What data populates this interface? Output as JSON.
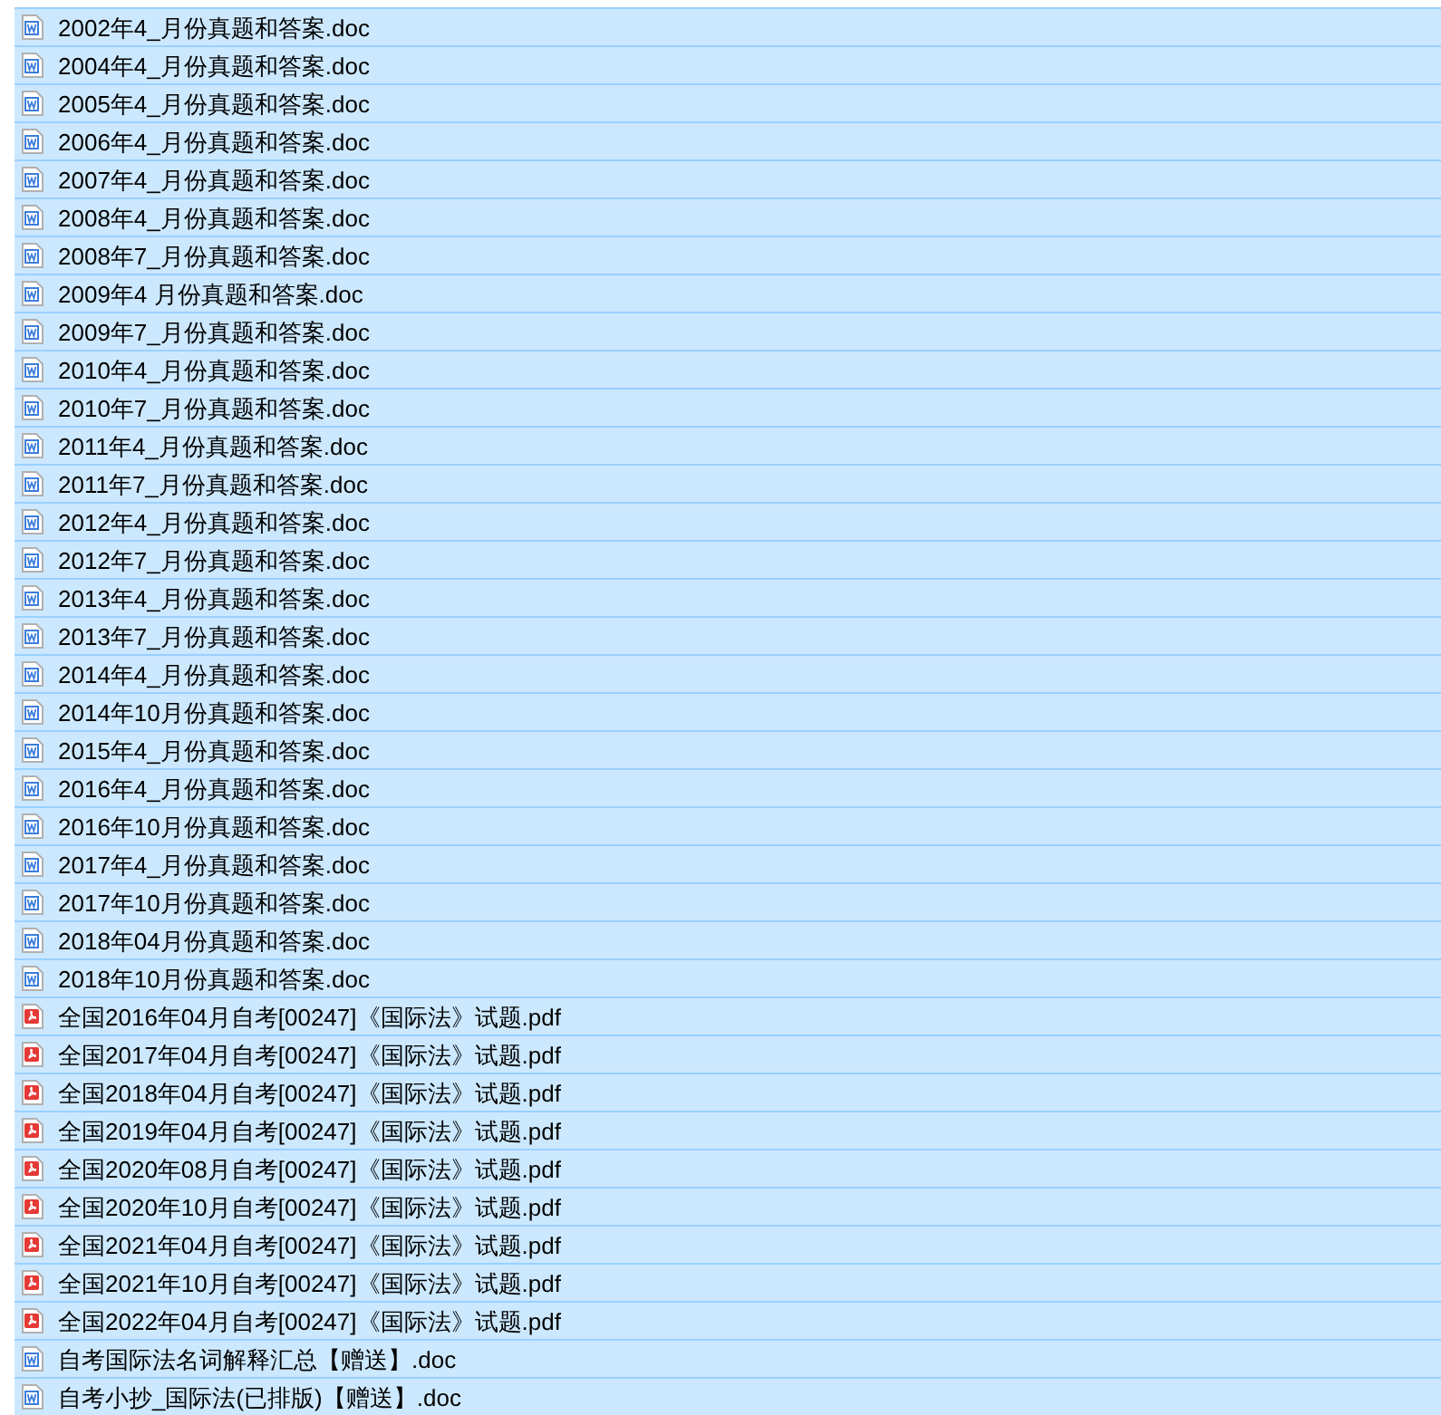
{
  "files": [
    {
      "name": "2002年4_月份真题和答案.doc",
      "kind": "doc",
      "selected": true
    },
    {
      "name": "2004年4_月份真题和答案.doc",
      "kind": "doc",
      "selected": true
    },
    {
      "name": "2005年4_月份真题和答案.doc",
      "kind": "doc",
      "selected": true
    },
    {
      "name": "2006年4_月份真题和答案.doc",
      "kind": "doc",
      "selected": true
    },
    {
      "name": "2007年4_月份真题和答案.doc",
      "kind": "doc",
      "selected": true
    },
    {
      "name": "2008年4_月份真题和答案.doc",
      "kind": "doc",
      "selected": true
    },
    {
      "name": "2008年7_月份真题和答案.doc",
      "kind": "doc",
      "selected": true
    },
    {
      "name": "2009年4 月份真题和答案.doc",
      "kind": "doc",
      "selected": true
    },
    {
      "name": "2009年7_月份真题和答案.doc",
      "kind": "doc",
      "selected": true
    },
    {
      "name": "2010年4_月份真题和答案.doc",
      "kind": "doc",
      "selected": true
    },
    {
      "name": "2010年7_月份真题和答案.doc",
      "kind": "doc",
      "selected": true
    },
    {
      "name": "2011年4_月份真题和答案.doc",
      "kind": "doc",
      "selected": true
    },
    {
      "name": "2011年7_月份真题和答案.doc",
      "kind": "doc",
      "selected": true
    },
    {
      "name": "2012年4_月份真题和答案.doc",
      "kind": "doc",
      "selected": true
    },
    {
      "name": "2012年7_月份真题和答案.doc",
      "kind": "doc",
      "selected": true
    },
    {
      "name": "2013年4_月份真题和答案.doc",
      "kind": "doc",
      "selected": true
    },
    {
      "name": "2013年7_月份真题和答案.doc",
      "kind": "doc",
      "selected": true
    },
    {
      "name": "2014年4_月份真题和答案.doc",
      "kind": "doc",
      "selected": true
    },
    {
      "name": "2014年10月份真题和答案.doc",
      "kind": "doc",
      "selected": true
    },
    {
      "name": "2015年4_月份真题和答案.doc",
      "kind": "doc",
      "selected": true
    },
    {
      "name": "2016年4_月份真题和答案.doc",
      "kind": "doc",
      "selected": true
    },
    {
      "name": "2016年10月份真题和答案.doc",
      "kind": "doc",
      "selected": true
    },
    {
      "name": "2017年4_月份真题和答案.doc",
      "kind": "doc",
      "selected": true
    },
    {
      "name": "2017年10月份真题和答案.doc",
      "kind": "doc",
      "selected": true
    },
    {
      "name": "2018年04月份真题和答案.doc",
      "kind": "doc",
      "selected": true
    },
    {
      "name": "2018年10月份真题和答案.doc",
      "kind": "doc",
      "selected": true
    },
    {
      "name": "全国2016年04月自考[00247]《国际法》试题.pdf",
      "kind": "pdf",
      "selected": true
    },
    {
      "name": "全国2017年04月自考[00247]《国际法》试题.pdf",
      "kind": "pdf",
      "selected": true
    },
    {
      "name": "全国2018年04月自考[00247]《国际法》试题.pdf",
      "kind": "pdf",
      "selected": true
    },
    {
      "name": "全国2019年04月自考[00247]《国际法》试题.pdf",
      "kind": "pdf",
      "selected": true
    },
    {
      "name": "全国2020年08月自考[00247]《国际法》试题.pdf",
      "kind": "pdf",
      "selected": true
    },
    {
      "name": "全国2020年10月自考[00247]《国际法》试题.pdf",
      "kind": "pdf",
      "selected": true
    },
    {
      "name": "全国2021年04月自考[00247]《国际法》试题.pdf",
      "kind": "pdf",
      "selected": true
    },
    {
      "name": "全国2021年10月自考[00247]《国际法》试题.pdf",
      "kind": "pdf",
      "selected": true
    },
    {
      "name": "全国2022年04月自考[00247]《国际法》试题.pdf",
      "kind": "pdf",
      "selected": true
    },
    {
      "name": "自考国际法名词解释汇总【赠送】.doc",
      "kind": "doc",
      "selected": true
    },
    {
      "name": "自考小抄_国际法(已排版)【赠送】.doc",
      "kind": "doc",
      "selected": true
    }
  ]
}
